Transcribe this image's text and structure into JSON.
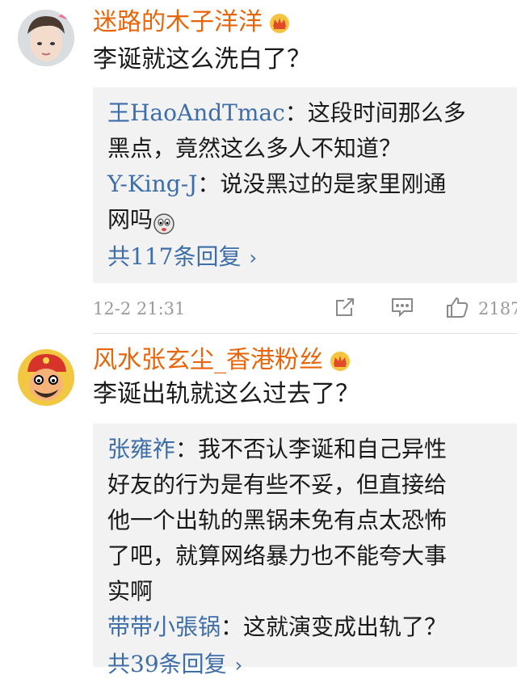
{
  "comments": [
    {
      "username": "迷路的木子洋洋",
      "text": "李诞就这么洗白了？",
      "replies": [
        {
          "user": "王HaoAndTmac",
          "lines": [
            "：这段时间那么多",
            "黑点，竟然这么多人不知道？"
          ]
        },
        {
          "user": "Y-King-J",
          "lines": [
            "：说没黑过的是家里刚通",
            "网吗"
          ]
        }
      ],
      "more_label": "共117条回复",
      "timestamp": "12-2 21:31",
      "likes": "2187"
    },
    {
      "username": "风水张玄尘_香港粉丝",
      "text": "李诞出轨就这么过去了？",
      "replies": [
        {
          "user": "张雍祚",
          "lines": [
            "：我不否认李诞和自己异性",
            "好友的行为是有些不妥，但直接给",
            "他一个出轨的黑锅未免有点太恐怖",
            "了吧，就算网络暴力也不能夸大事",
            "实啊"
          ]
        },
        {
          "user": "带带小張锅",
          "lines": [
            "：这就演变成出轨了？"
          ]
        }
      ],
      "more_label": "共39条回复"
    }
  ],
  "colors": {
    "username": "#e8650a",
    "reply_user": "#3e6ea8",
    "reply_bg": "#f2f2f2",
    "meta": "#9a9a9a"
  },
  "icons": [
    "crown-icon",
    "share-icon",
    "comment-icon",
    "like-icon",
    "chevron-right-icon",
    "emoji-icon"
  ]
}
